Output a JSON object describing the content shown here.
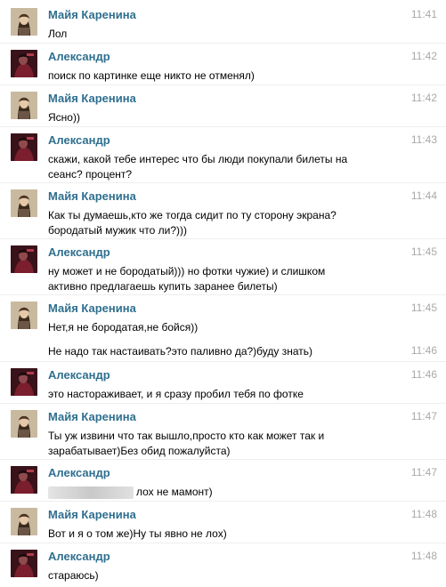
{
  "messages": [
    {
      "sender": "Майя Каренина",
      "time": "11:41",
      "text": "Лол",
      "avatar": "maya-avatar"
    },
    {
      "sender": "Александр",
      "time": "11:42",
      "text": "поиск по картинке еще никто не отменял)",
      "avatar": "alexander-avatar"
    },
    {
      "sender": "Майя Каренина",
      "time": "11:42",
      "text": "Ясно))",
      "avatar": "maya-avatar"
    },
    {
      "sender": "Александр",
      "time": "11:43",
      "text_lines": [
        "скажи, какой тебе интерес что бы люди покупали билеты на",
        "сеанс? процент?"
      ],
      "avatar": "alexander-avatar"
    },
    {
      "sender": "Майя Каренина",
      "time": "11:44",
      "text_lines": [
        "Как ты думаешь,кто же тогда сидит по ту сторону экрана?",
        "бородатый мужик что ли?)))"
      ],
      "avatar": "maya-avatar"
    },
    {
      "sender": "Александр",
      "time": "11:45",
      "text_lines": [
        "ну может и не бородатый))) но фотки чужие) и слишком",
        "активно предлагаешь купить заранее билеты)"
      ],
      "avatar": "alexander-avatar"
    },
    {
      "sender": "Майя Каренина",
      "time": "11:45",
      "text": "Нет,я не бородатая,не бойся))",
      "avatar": "maya-avatar"
    },
    {
      "time": "11:46",
      "text": "Не надо так настаивать?это паливно да?)буду знать)"
    },
    {
      "sender": "Александр",
      "time": "11:46",
      "text": "это настораживает, и я сразу пробил тебя по фотке",
      "avatar": "alexander-avatar"
    },
    {
      "sender": "Майя Каренина",
      "time": "11:47",
      "text_lines": [
        "Ты уж извини что так вышло,просто кто как может так и",
        "зарабатывает)Без обид пожалуйста)"
      ],
      "avatar": "maya-avatar"
    },
    {
      "sender": "Александр",
      "time": "11:47",
      "text": "лох не мамонт)",
      "redacted_prefix": true,
      "avatar": "alexander-avatar"
    },
    {
      "sender": "Майя Каренина",
      "time": "11:48",
      "text": "Вот и я о том же)Ну ты явно не лох)",
      "avatar": "maya-avatar"
    },
    {
      "sender": "Александр",
      "time": "11:48",
      "text": "стараюсь)",
      "avatar": "alexander-avatar"
    }
  ],
  "colors": {
    "name": "#2f6f8f",
    "time": "#a9a9a9",
    "text": "#000000"
  }
}
